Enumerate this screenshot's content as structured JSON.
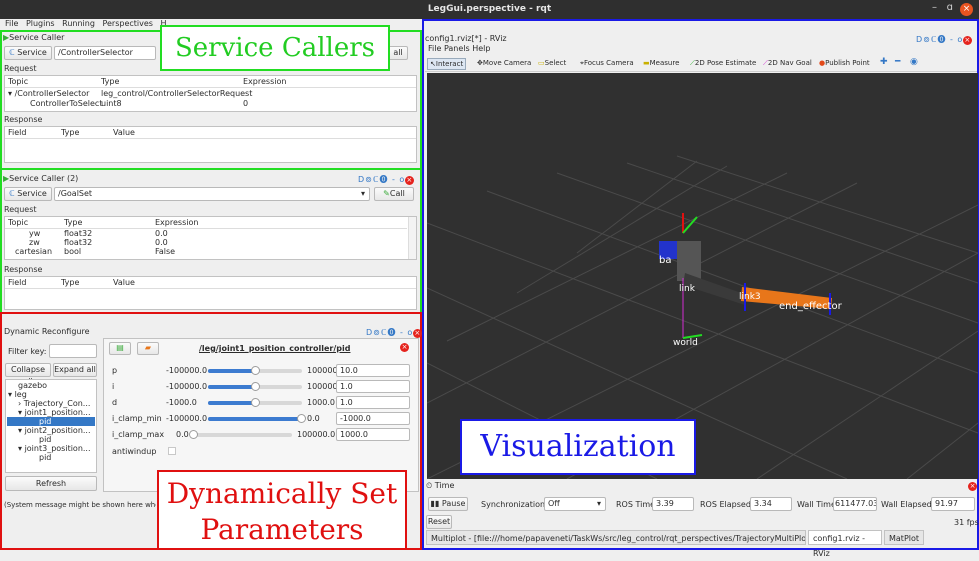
{
  "window": {
    "title": "LegGui.perspective - rqt",
    "min": "–",
    "max": "ɑ",
    "close": "×"
  },
  "menubar": {
    "items": [
      "File",
      "Plugins",
      "Running",
      "Perspectives",
      "H"
    ]
  },
  "service_caller_1": {
    "title": "Service Caller",
    "service_label": "Service",
    "service_value": "/ControllerSelector",
    "call_label": "all",
    "request_label": "Request",
    "req_columns": [
      "Topic",
      "Type",
      "Expression"
    ],
    "req_rows": [
      {
        "topic": "/ControllerSelector",
        "type": "leg_control/ControllerSelectorRequest",
        "expr": ""
      },
      {
        "topic": "ControllerToSelect",
        "type": "uint8",
        "expr": "0"
      }
    ],
    "response_label": "Response",
    "resp_columns": [
      "Field",
      "Type",
      "Value"
    ]
  },
  "service_caller_2": {
    "title": "Service Caller (2)",
    "service_label": "Service",
    "service_value": "/GoalSet",
    "call_label": "Call",
    "request_label": "Request",
    "req_columns": [
      "Topic",
      "Type",
      "Expression"
    ],
    "req_rows": [
      {
        "topic": "yw",
        "type": "float32",
        "expr": "0.0"
      },
      {
        "topic": "zw",
        "type": "float32",
        "expr": "0.0"
      },
      {
        "topic": "cartesian",
        "type": "bool",
        "expr": "False"
      }
    ],
    "response_label": "Response",
    "resp_columns": [
      "Field",
      "Type",
      "Value"
    ],
    "dock_icons": "D⊚ℂ⓿  - o"
  },
  "dynamic_reconfigure": {
    "title": "Dynamic Reconfigure",
    "filter_label": "Filter key:",
    "collapse_label": "Collapse all",
    "expand_label": "Expand all",
    "tree": [
      "gazebo",
      "leg",
      "Trajectory_Con...",
      "joint1_position...",
      "pid",
      "joint2_position...",
      "pid",
      "joint3_position...",
      "pid"
    ],
    "refresh_label": "Refresh",
    "node_title": "/leg/joint1_position_controller/pid",
    "params": [
      {
        "name": "p",
        "min": "-100000.0",
        "max": "100000.0",
        "value": "10.0",
        "frac": 0.5
      },
      {
        "name": "i",
        "min": "-100000.0",
        "max": "100000.0",
        "value": "1.0",
        "frac": 0.5
      },
      {
        "name": "d",
        "min": "-1000.0",
        "max": "1000.0",
        "value": "1.0",
        "frac": 0.5
      },
      {
        "name": "i_clamp_min",
        "min": "-100000.0",
        "max": "0.0",
        "value": "-1000.0",
        "frac": 0.99
      },
      {
        "name": "i_clamp_max",
        "min": "0.0",
        "max": "100000.0",
        "value": "1000.0",
        "frac": 0.01
      }
    ],
    "antiwindup_label": "antiwindup",
    "status_message": "(System message might be shown here when ne",
    "dock_icons": "D⊚ℂ⓿  - o"
  },
  "rviz": {
    "title": "config1.rviz[*] - RViz",
    "menu": [
      "File",
      "Panels",
      "Help"
    ],
    "tools": [
      "Interact",
      "Move Camera",
      "Select",
      "Focus Camera",
      "Measure",
      "2D Pose Estimate",
      "2D Nav Goal",
      "Publish Point"
    ],
    "labels": [
      "ba",
      "link",
      "link3",
      "end_effector",
      "world"
    ],
    "dock_icons": "D⊚ℂ⓿  - o"
  },
  "time_panel": {
    "title": "Time",
    "pause_label": "Pause",
    "sync_label": "Synchronization:",
    "sync_value": "Off",
    "ros_time_label": "ROS Time:",
    "ros_time": "3.39",
    "ros_elapsed_label": "ROS Elapsed:",
    "ros_elapsed": "3.34",
    "wall_time_label": "Wall Time:",
    "wall_time": "611477.03",
    "wall_elapsed_label": "Wall Elapsed:",
    "wall_elapsed": "91.97",
    "reset_label": "Reset",
    "fps": "31 fps"
  },
  "tabs": [
    "Multiplot - [file:///home/papaveneti/TaskWs/src/leg_control/rqt_perspectives/TrajectoryMultiPlot.xml]",
    "config1.rviz - RViz",
    "MatPlot"
  ],
  "annotations": {
    "service_callers": "Service Callers",
    "visualization": "Visualization",
    "dyn_line1": "Dynamically Set",
    "dyn_line2": "Parameters"
  },
  "colors": {
    "green": "#22dd22",
    "blue": "#1a1ae6",
    "red": "#e01010",
    "orange": "#e8761a",
    "rviz_bg": "#303030"
  }
}
